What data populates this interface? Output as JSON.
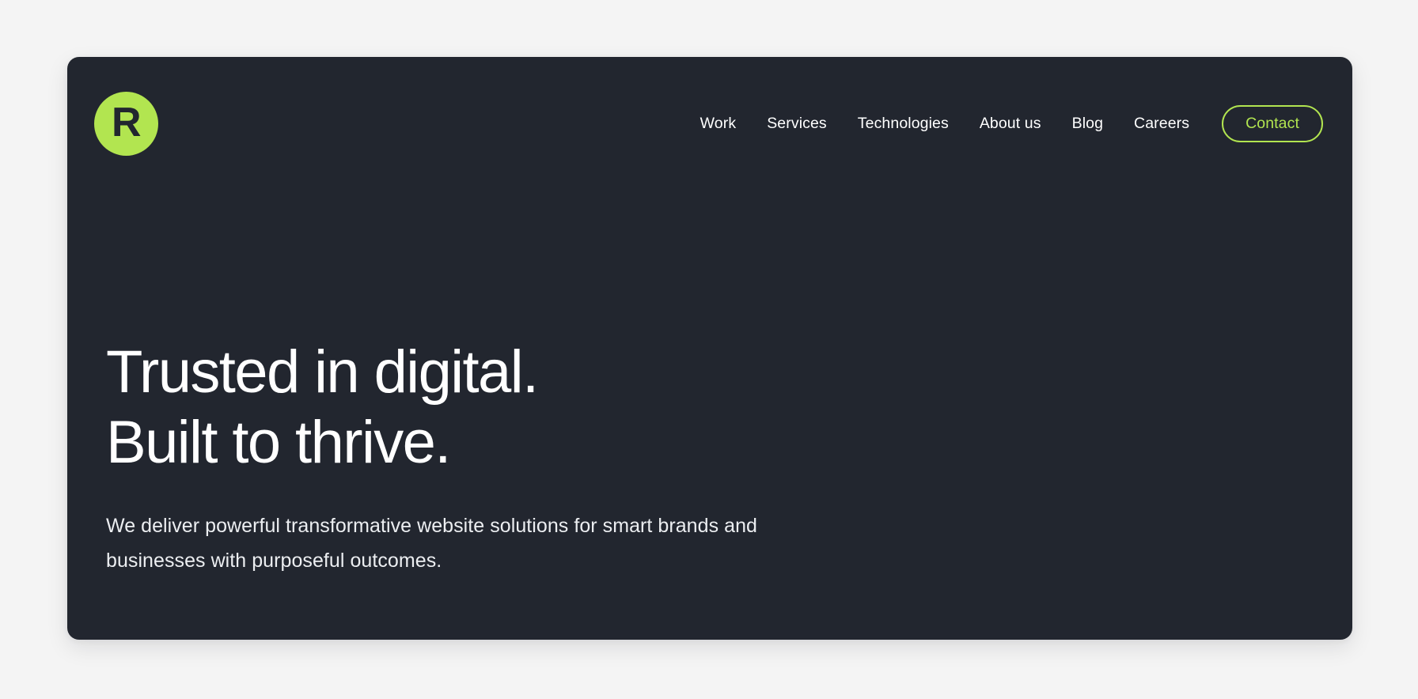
{
  "theme": {
    "page_background": "#f4f4f4",
    "card_background": "#22262f",
    "accent_green": "#b2e550",
    "text_primary": "#ffffff",
    "text_secondary": "#eceef1"
  },
  "header": {
    "logo": {
      "letter": "R",
      "icon_name": "brand-logo-circle"
    },
    "nav_items": [
      {
        "label": "Work"
      },
      {
        "label": "Services"
      },
      {
        "label": "Technologies"
      },
      {
        "label": "About us"
      },
      {
        "label": "Blog"
      },
      {
        "label": "Careers"
      }
    ],
    "cta": {
      "label": "Contact"
    }
  },
  "hero": {
    "title_line_1": "Trusted in digital.",
    "title_line_2": "Built to thrive.",
    "subtitle_line_1": "We deliver powerful transformative website solutions for smart brands and",
    "subtitle_line_2": "businesses with purposeful outcomes."
  }
}
